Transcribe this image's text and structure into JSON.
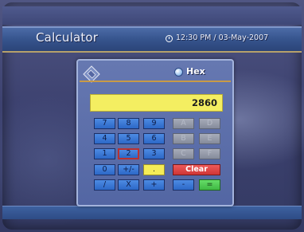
{
  "app": {
    "title": "Calculator",
    "time": "12:30 PM",
    "date_separator": "/",
    "date": "03-May-2007"
  },
  "calculator": {
    "mode_label": "Hex",
    "display_value": "2860",
    "focused_key": "2",
    "keys": {
      "k7": "7",
      "k8": "8",
      "k9": "9",
      "kA": "A",
      "kD": "D",
      "k4": "4",
      "k5": "5",
      "k6": "6",
      "kB": "B",
      "kE": "E",
      "k1": "1",
      "k2": "2",
      "k3": "3",
      "kC": "C",
      "kF": "F",
      "k0": "0",
      "kSign": "+/-",
      "kDot": ".",
      "kClear": "Clear",
      "kDiv": "/",
      "kMul": "X",
      "kAdd": "+",
      "kSub": "-",
      "kEq": "="
    }
  },
  "colors": {
    "title_bar": "#36548d",
    "accent_gold": "#c89a48",
    "number_key": "#3a7ad6",
    "disabled_key": "#9196a4",
    "display": "#f4ee61",
    "clear_key": "#e04444",
    "equals_key": "#55cc58"
  },
  "icons": [
    "clock-icon",
    "calculator-icon",
    "radio-selected-icon"
  ]
}
